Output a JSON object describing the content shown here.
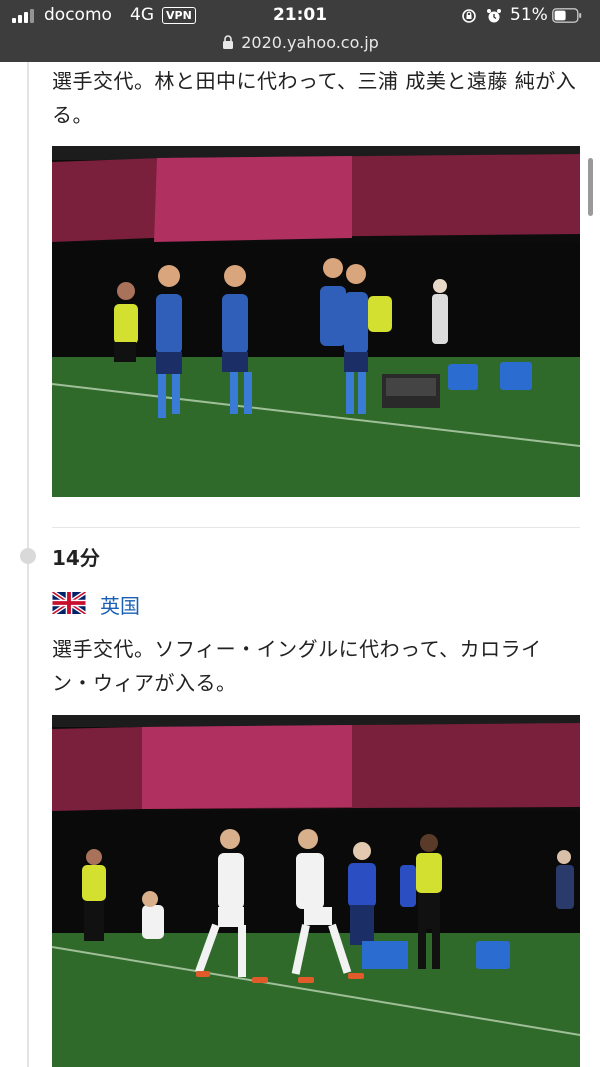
{
  "status_bar": {
    "carrier": "docomo",
    "network": "4G",
    "vpn": "VPN",
    "time": "21:01",
    "battery_percent": "51%"
  },
  "browser": {
    "url": "2020.yahoo.co.jp"
  },
  "feed": {
    "entry1": {
      "text": "選手交代。林と田中に代わって、三浦 成美と遠藤 純が入る。"
    },
    "entry2": {
      "minute": "14分",
      "team": "英国",
      "text": "選手交代。ソフィー・イングルに代わって、カロライン・ウィアが入る。"
    }
  },
  "icons": {
    "signal": "cellular-signal-icon",
    "lock": "lock-icon",
    "rotation": "rotation-lock-icon",
    "alarm": "alarm-icon",
    "battery": "battery-icon",
    "flag": "uk-flag-icon"
  },
  "colors": {
    "status_bar_bg": "#3d3d3d",
    "team_link": "#1a5fb4",
    "pitch_green": "#2f6a2a",
    "stadium_pink": "#b03060"
  }
}
